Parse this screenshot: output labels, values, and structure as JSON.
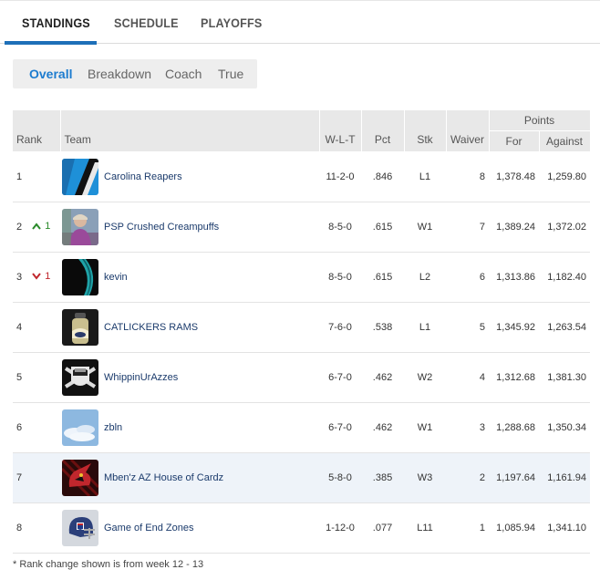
{
  "nav": {
    "tabs": [
      {
        "label": "STANDINGS",
        "active": true
      },
      {
        "label": "SCHEDULE",
        "active": false
      },
      {
        "label": "PLAYOFFS",
        "active": false
      }
    ],
    "accent_color": "#1d6fb8"
  },
  "view_tabs": [
    {
      "label": "Overall",
      "active": true
    },
    {
      "label": "Breakdown",
      "active": false
    },
    {
      "label": "Coach",
      "active": false
    },
    {
      "label": "True",
      "active": false
    }
  ],
  "table": {
    "headers": {
      "rank": "Rank",
      "team": "Team",
      "wlt": "W-L-T",
      "pct": "Pct",
      "stk": "Stk",
      "waiver": "Waiver",
      "points": "Points",
      "for": "For",
      "against": "Against"
    },
    "rows": [
      {
        "rank": "1",
        "change_dir": "",
        "change": "",
        "team": "Carolina Reapers",
        "avatar": "panthers-stripe-icon",
        "wlt": "11-2-0",
        "pct": ".846",
        "stk": "L1",
        "waiver": "8",
        "pf": "1,378.48",
        "pa": "1,259.80"
      },
      {
        "rank": "2",
        "change_dir": "up",
        "change": "1",
        "team": "PSP Crushed Creampuffs",
        "avatar": "person-photo-icon",
        "wlt": "8-5-0",
        "pct": ".615",
        "stk": "W1",
        "waiver": "7",
        "pf": "1,389.24",
        "pa": "1,372.02"
      },
      {
        "rank": "3",
        "change_dir": "down",
        "change": "1",
        "team": "kevin",
        "avatar": "teal-swoosh-icon",
        "wlt": "8-5-0",
        "pct": ".615",
        "stk": "L2",
        "waiver": "6",
        "pf": "1,313.86",
        "pa": "1,182.40"
      },
      {
        "rank": "4",
        "change_dir": "",
        "change": "",
        "team": "CATLICKERS RAMS",
        "avatar": "rams-helmet-icon",
        "wlt": "7-6-0",
        "pct": ".538",
        "stk": "L1",
        "waiver": "5",
        "pf": "1,345.92",
        "pa": "1,263.54"
      },
      {
        "rank": "5",
        "change_dir": "",
        "change": "",
        "team": "WhippinUrAzzes",
        "avatar": "raiders-shield-icon",
        "wlt": "6-7-0",
        "pct": ".462",
        "stk": "W2",
        "waiver": "4",
        "pf": "1,312.68",
        "pa": "1,381.30"
      },
      {
        "rank": "6",
        "change_dir": "",
        "change": "",
        "team": "zbln",
        "avatar": "sky-clouds-icon",
        "wlt": "6-7-0",
        "pct": ".462",
        "stk": "W1",
        "waiver": "3",
        "pf": "1,288.68",
        "pa": "1,350.34"
      },
      {
        "rank": "7",
        "change_dir": "",
        "change": "",
        "team": "Mben'z AZ House of Cardz",
        "avatar": "cardinal-head-icon",
        "wlt": "5-8-0",
        "pct": ".385",
        "stk": "W3",
        "waiver": "2",
        "pf": "1,197.64",
        "pa": "1,161.94"
      },
      {
        "rank": "8",
        "change_dir": "",
        "change": "",
        "team": "Game of End Zones",
        "avatar": "nfl-helmet-icon",
        "wlt": "1-12-0",
        "pct": ".077",
        "stk": "L11",
        "waiver": "1",
        "pf": "1,085.94",
        "pa": "1,341.10"
      }
    ]
  },
  "footnote": "* Rank change shown is from week 12 - 13"
}
